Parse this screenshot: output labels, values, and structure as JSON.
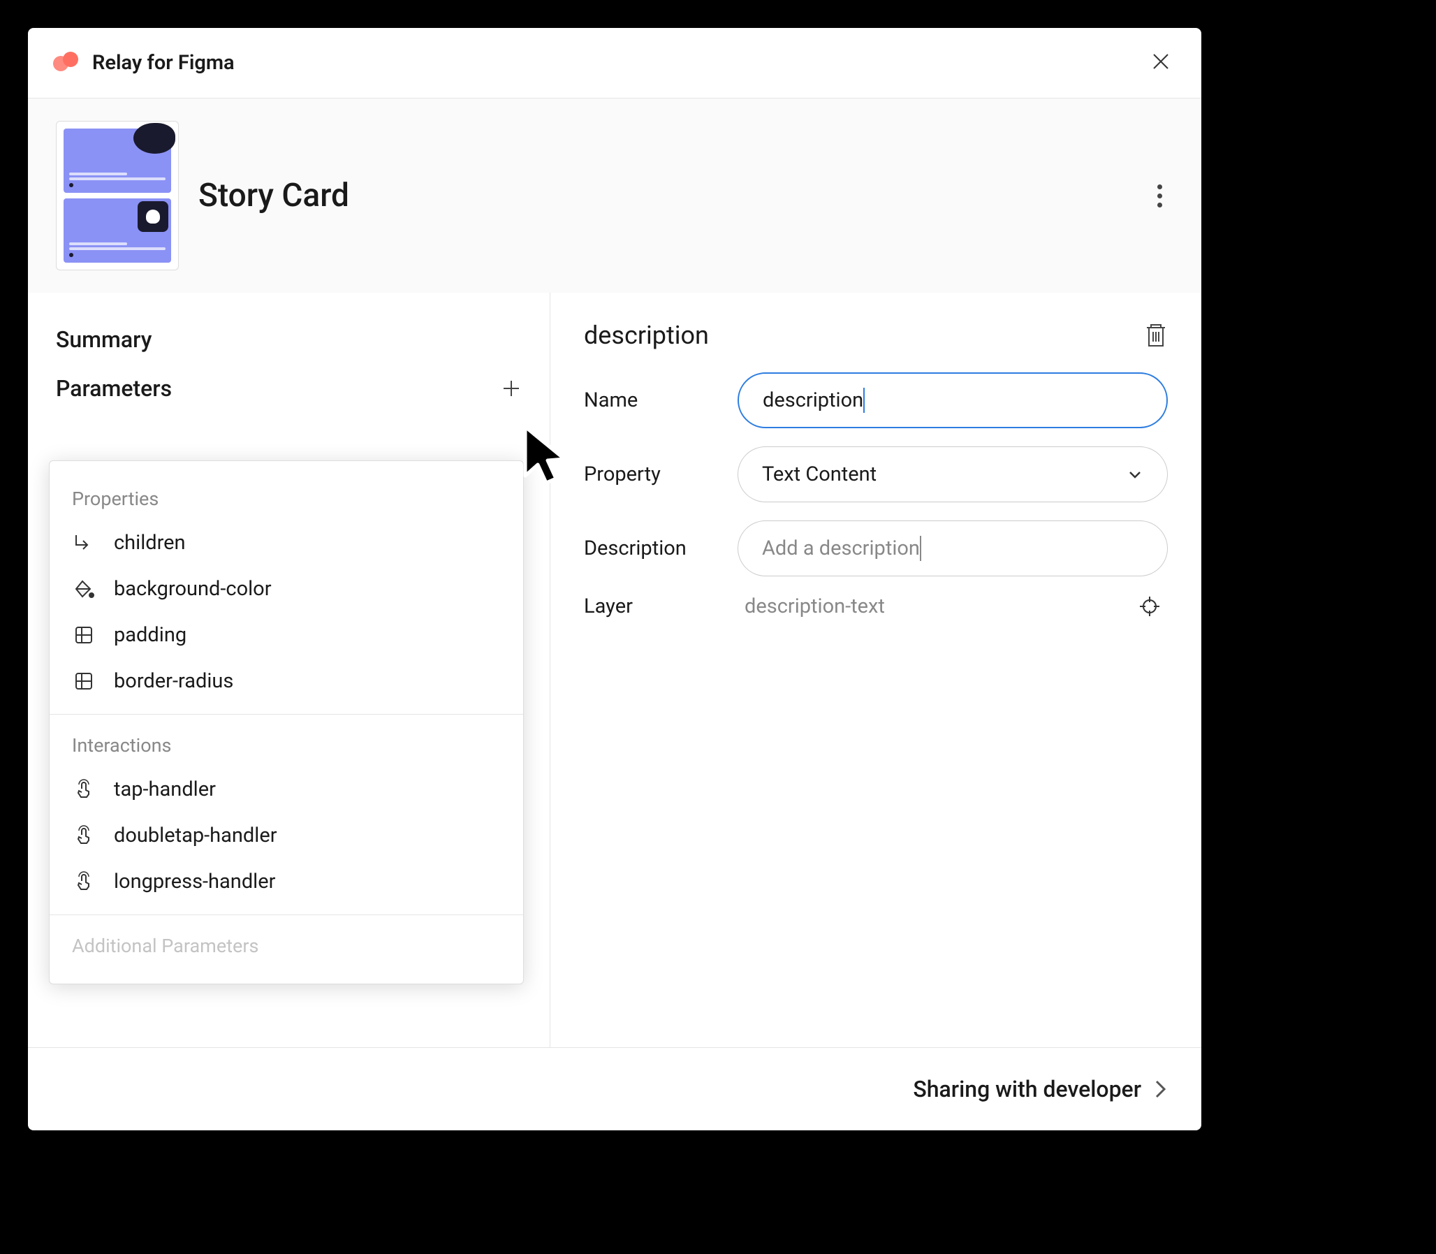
{
  "app": {
    "title": "Relay for Figma"
  },
  "header": {
    "component_name": "Story Card"
  },
  "left": {
    "summary_label": "Summary",
    "parameters_label": "Parameters"
  },
  "popover": {
    "group_properties": "Properties",
    "group_interactions": "Interactions",
    "group_additional": "Additional Parameters",
    "properties": [
      {
        "label": "children",
        "icon": "children-icon"
      },
      {
        "label": "background-color",
        "icon": "bucket-icon"
      },
      {
        "label": "padding",
        "icon": "box-icon"
      },
      {
        "label": "border-radius",
        "icon": "box-icon"
      }
    ],
    "interactions": [
      {
        "label": "tap-handler",
        "icon": "tap-icon"
      },
      {
        "label": "doubletap-handler",
        "icon": "tap-icon"
      },
      {
        "label": "longpress-handler",
        "icon": "tap-icon"
      }
    ]
  },
  "detail": {
    "title": "description",
    "name_label": "Name",
    "name_value": "description",
    "property_label": "Property",
    "property_value": "Text Content",
    "description_label": "Description",
    "description_placeholder": "Add a description",
    "layer_label": "Layer",
    "layer_value": "description-text"
  },
  "footer": {
    "label": "Sharing with developer"
  }
}
